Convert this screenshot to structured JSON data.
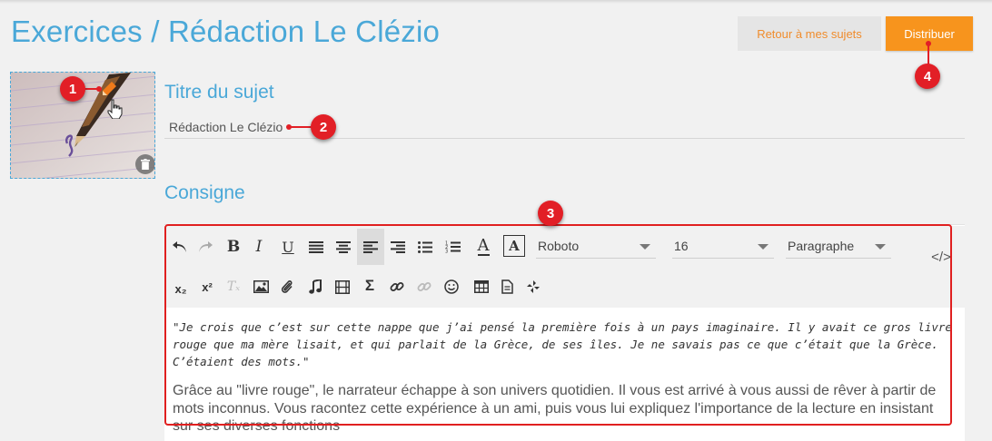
{
  "header": {
    "title": "Exercices / Rédaction Le Clézio",
    "back_label": "Retour à mes sujets",
    "distribute_label": "Distribuer"
  },
  "subject": {
    "heading": "Titre du sujet",
    "value": "Rédaction Le Clézio"
  },
  "consigne": {
    "heading": "Consigne"
  },
  "toolbar": {
    "row1": [
      "undo-icon",
      "redo-icon",
      "bold-icon",
      "italic-icon",
      "underline-icon",
      "align-justify-icon",
      "align-center-icon",
      "align-left-icon",
      "align-right-icon",
      "bullet-list-icon",
      "numbered-list-icon",
      "text-color-icon",
      "background-color-icon"
    ],
    "row2": [
      "subscript-icon",
      "superscript-icon",
      "clear-format-icon",
      "image-icon",
      "attachment-icon",
      "audio-icon",
      "video-icon",
      "formula-icon",
      "link-icon",
      "unlink-icon",
      "emoji-icon",
      "table-icon",
      "document-icon",
      "special-icon"
    ],
    "font_family": "Roboto",
    "font_size": "16",
    "block_format": "Paragraphe",
    "bold_glyph": "B",
    "italic_glyph": "I",
    "underline_glyph": "U",
    "text_color_glyph": "A",
    "bg_color_glyph": "A",
    "subscript_glyph": "x₂",
    "superscript_glyph": "x²",
    "clear_glyph": "Tₓ",
    "formula_glyph": "Σ",
    "code_glyph": "</>"
  },
  "content": {
    "quote": "\"Je crois que c’est sur cette nappe que j’ai pensé la première fois à un pays imaginaire. Il y avait ce gros livre rouge que ma mère lisait, et qui parlait de la Grèce, de ses îles. Je ne savais pas ce que c’était que la Grèce. C’étaient des mots.\"",
    "paragraph": "Grâce au \"livre rouge\", le narrateur échappe à son univers quotidien. Il vous est arrivé à vous aussi de rêver à partir de mots inconnus. Vous racontez cette expérience à un ami, puis vous lui expliquez l'importance de la lecture en insistant sur ses diverses fonctions"
  },
  "annotations": [
    "1",
    "2",
    "3",
    "4"
  ],
  "colors": {
    "accent": "#4aa8d8",
    "primary_button": "#f7941d",
    "marker": "#e21f26"
  }
}
